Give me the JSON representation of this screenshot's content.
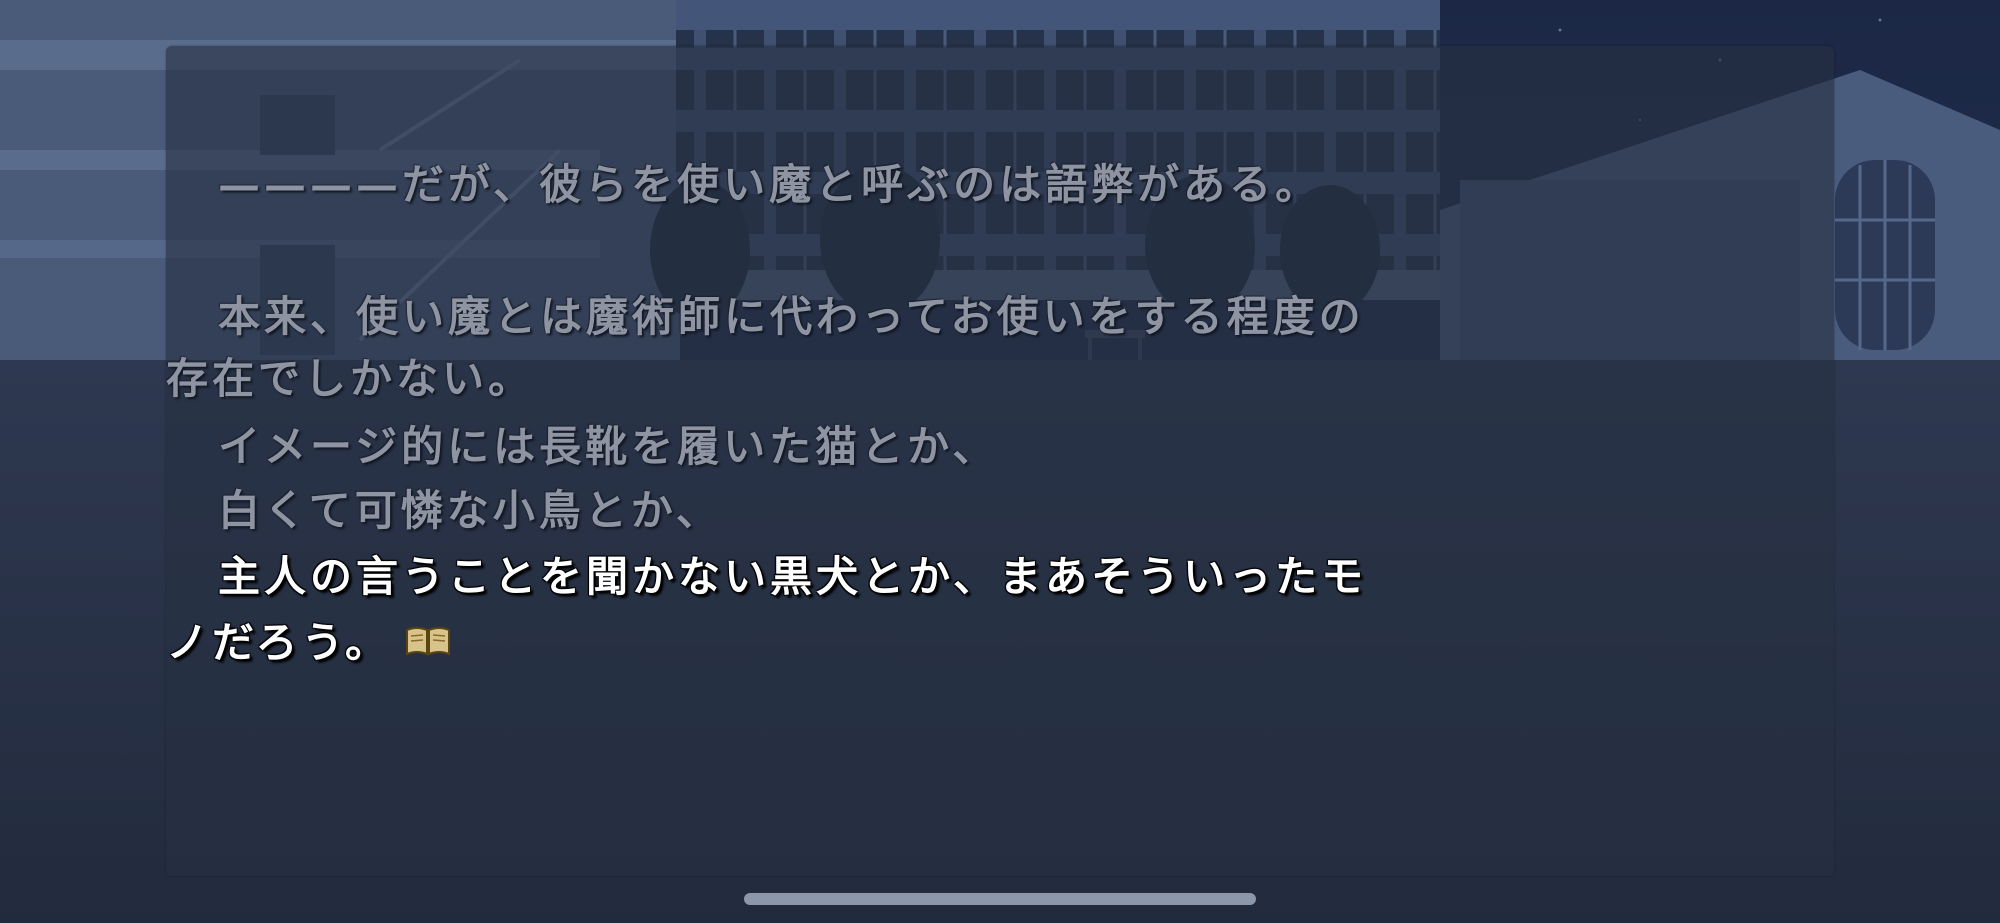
{
  "scene": {
    "background_description_colors": {
      "sky": "#1a2540",
      "building": "#3a4a66",
      "ground": "#283246"
    }
  },
  "dialogue": {
    "lines": [
      {
        "text": "————だが、彼らを使い魔と呼ぶのは語弊がある。",
        "state": "read"
      },
      {
        "text": "本来、使い魔とは魔術師に代わってお使いをする程度の",
        "state": "read"
      },
      {
        "text": "存在でしかない。",
        "state": "read"
      },
      {
        "text": "イメージ的には長靴を履いた猫とか、",
        "state": "read"
      },
      {
        "text": "白くて可憐な小鳥とか、",
        "state": "read"
      },
      {
        "text": "主人の言うことを聞かない黒犬とか、まあそういったモ",
        "state": "current"
      },
      {
        "text": "ノだろう。",
        "state": "current"
      }
    ],
    "page_end_icon": "open-book-icon",
    "colors": {
      "read_text": "#8e94a2",
      "current_text": "#ffffff"
    }
  },
  "system": {
    "home_indicator": "home-indicator"
  }
}
